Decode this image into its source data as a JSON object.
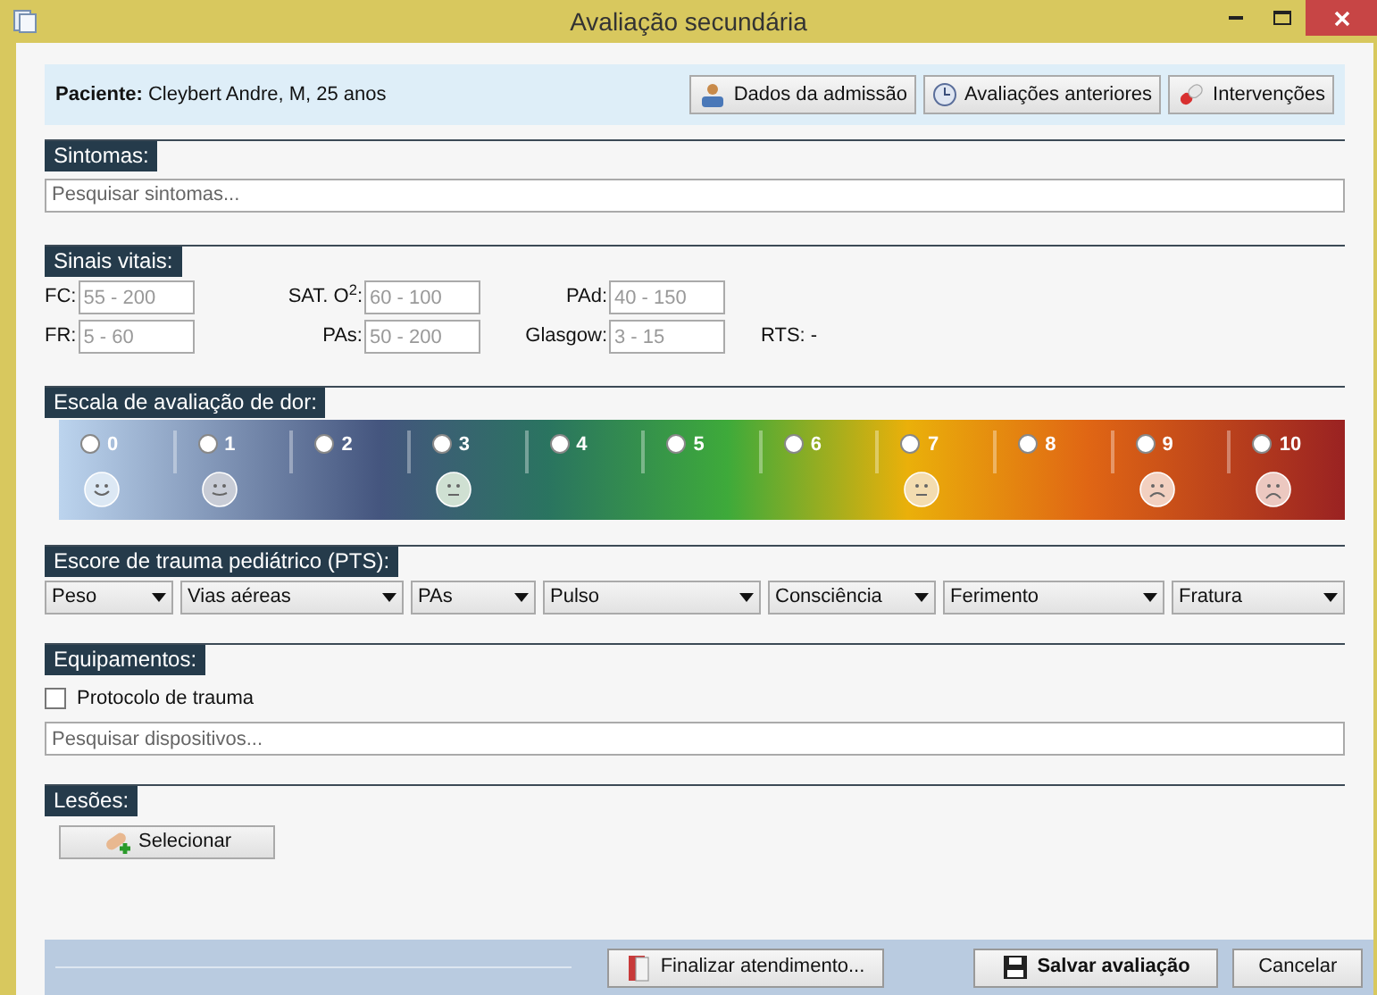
{
  "window": {
    "title": "Avaliação secundária"
  },
  "patient": {
    "label": "Paciente:",
    "value": "Cleybert Andre, M, 25 anos"
  },
  "header_buttons": [
    {
      "label": "Dados da admissão",
      "kind": "admission"
    },
    {
      "label": "Avaliações anteriores",
      "kind": "history"
    },
    {
      "label": "Intervenções",
      "kind": "pill"
    }
  ],
  "symptoms": {
    "title": "Sintomas:",
    "placeholder": "Pesquisar sintomas..."
  },
  "vitals": {
    "title": "Sinais vitais:",
    "rows": [
      [
        {
          "label": "FC:",
          "placeholder": "55 - 200"
        },
        {
          "label": "SAT. O$^{2}$:",
          "placeholder": "60 - 100"
        },
        {
          "label": "PAd:",
          "placeholder": "40 - 150"
        }
      ],
      [
        {
          "label": "FR:",
          "placeholder": "5 - 60"
        },
        {
          "label": "PAs:",
          "placeholder": "50 - 200"
        },
        {
          "label": "Glasgow:",
          "placeholder": "3 - 15"
        }
      ]
    ],
    "rts": "RTS: -"
  },
  "pain_scale": {
    "title": "Escala de avaliação de dor:",
    "levels": [
      {
        "label": "0",
        "selected": false,
        "kind": "happy"
      },
      {
        "label": "1",
        "selected": false,
        "kind": "grin"
      },
      {
        "label": "2",
        "selected": false,
        "kind": "blank"
      },
      {
        "label": "3",
        "selected": false,
        "kind": "neutral"
      },
      {
        "label": "4",
        "selected": false,
        "kind": "blank"
      },
      {
        "label": "5",
        "selected": false,
        "kind": "blank"
      },
      {
        "label": "6",
        "selected": false,
        "kind": "blank"
      },
      {
        "label": "7",
        "selected": false,
        "kind": "flat"
      },
      {
        "label": "8",
        "selected": false,
        "kind": "blank"
      },
      {
        "label": "9",
        "selected": false,
        "kind": "sad"
      },
      {
        "label": "10",
        "selected": false,
        "kind": "crying"
      }
    ]
  },
  "pts": {
    "title": "Escore de trauma pediátrico (PTS):",
    "dropdowns": [
      "Peso",
      "Vias aéreas",
      "PAs",
      "Pulso",
      "Consciência",
      "Ferimento",
      "Fratura"
    ]
  },
  "equipment": {
    "title": "Equipamentos:",
    "checkbox": {
      "label": "Protocolo de trauma",
      "checked": false
    },
    "placeholder": "Pesquisar dispositivos..."
  },
  "injuries": {
    "title": "Lesões:",
    "button": "Selecionar"
  },
  "footer": {
    "buttons": [
      {
        "label": "Finalizar atendimento...",
        "kind": "finish"
      },
      {
        "label": "Salvar avaliação",
        "kind": "save"
      },
      {
        "label": "Cancelar",
        "kind": "cancel"
      }
    ]
  }
}
